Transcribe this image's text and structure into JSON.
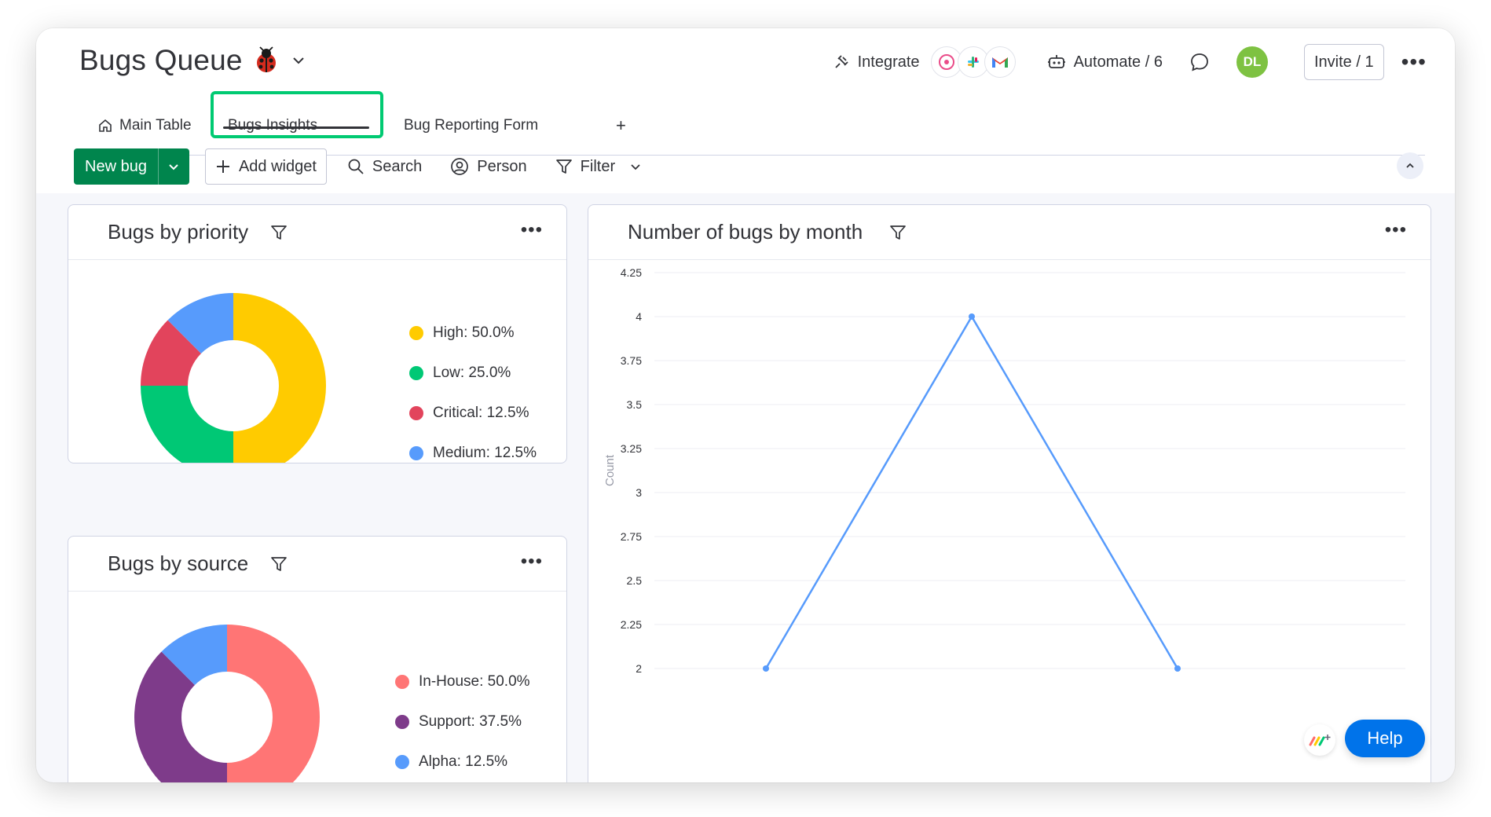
{
  "board": {
    "title": "Bugs Queue",
    "emoji_icon": "ladybug-icon"
  },
  "header": {
    "integrate_label": "Integrate",
    "integrations": [
      "dribbble-icon",
      "slack-icon",
      "gmail-icon"
    ],
    "automate_label": "Automate / 6",
    "avatar_initials": "DL",
    "avatar_color": "#7ec242",
    "invite_label": "Invite / 1"
  },
  "tabs": [
    {
      "label": "Main Table",
      "icon": "home-icon",
      "active": false
    },
    {
      "label": "Bugs Insights",
      "active": true
    },
    {
      "label": "Bug Reporting Form",
      "active": false
    },
    {
      "label": "+",
      "active": false
    }
  ],
  "toolbar": {
    "new_label": "New bug",
    "add_widget_label": "Add widget",
    "search_label": "Search",
    "person_label": "Person",
    "filter_label": "Filter"
  },
  "widgets": {
    "priority": {
      "title": "Bugs by priority",
      "legend": [
        {
          "label": "High: 50.0%",
          "color": "#ffcb00"
        },
        {
          "label": "Low: 25.0%",
          "color": "#00c875"
        },
        {
          "label": "Critical: 12.5%",
          "color": "#e2445c"
        },
        {
          "label": "Medium: 12.5%",
          "color": "#579bfc"
        }
      ]
    },
    "source": {
      "title": "Bugs by source",
      "legend": [
        {
          "label": "In-House: 50.0%",
          "color": "#ff7575"
        },
        {
          "label": "Support: 37.5%",
          "color": "#7e3b8a"
        },
        {
          "label": "Alpha: 12.5%",
          "color": "#579bfc"
        }
      ]
    },
    "month": {
      "title": "Number of bugs by month"
    }
  },
  "chart_data": [
    {
      "type": "pie",
      "title": "Bugs by priority",
      "categories": [
        "High",
        "Low",
        "Critical",
        "Medium"
      ],
      "values": [
        50.0,
        25.0,
        12.5,
        12.5
      ],
      "colors": [
        "#ffcb00",
        "#00c875",
        "#e2445c",
        "#579bfc"
      ],
      "legend": "right"
    },
    {
      "type": "pie",
      "title": "Bugs by source",
      "categories": [
        "In-House",
        "Support",
        "Alpha"
      ],
      "values": [
        50.0,
        37.5,
        12.5
      ],
      "colors": [
        "#ff7575",
        "#7e3b8a",
        "#579bfc"
      ],
      "legend": "right"
    },
    {
      "type": "line",
      "title": "Number of bugs by month",
      "ylabel": "Count",
      "ylim": [
        2,
        4.25
      ],
      "yticks": [
        "4.25",
        "4",
        "3.75",
        "3.5",
        "3.25",
        "3",
        "2.75",
        "2.5",
        "2.25",
        "2"
      ],
      "series": [
        {
          "values": [
            2,
            4,
            2
          ],
          "color": "#579bfc"
        }
      ],
      "grid": true
    }
  ],
  "help_label": "Help"
}
